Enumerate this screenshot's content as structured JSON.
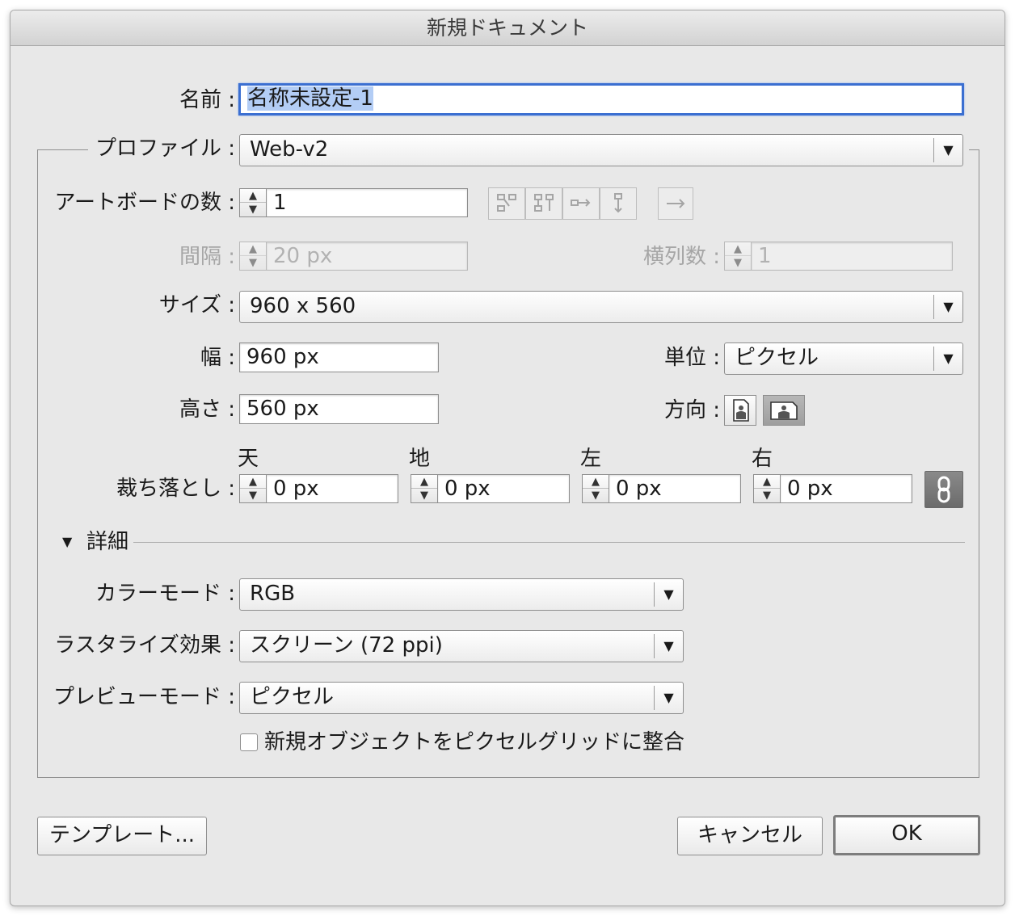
{
  "window": {
    "title": "新規ドキュメント"
  },
  "name": {
    "label": "名前 :",
    "value": "名称未設定-1"
  },
  "profile": {
    "label": "プロファイル :",
    "value": "Web-v2"
  },
  "artboards": {
    "label": "アートボードの数 :",
    "value": "1",
    "spacing_label": "間隔 :",
    "spacing_value": "20 px",
    "columns_label": "横列数 :",
    "columns_value": "1",
    "layout_icons": [
      "grid-by-row-icon",
      "grid-by-column-icon",
      "arrange-by-row-icon",
      "arrange-by-column-icon",
      "right-to-left-icon"
    ]
  },
  "size": {
    "label": "サイズ :",
    "value": "960 x 560"
  },
  "width": {
    "label": "幅 :",
    "value": "960 px"
  },
  "height": {
    "label": "高さ :",
    "value": "560 px"
  },
  "units": {
    "label": "単位 :",
    "value": "ピクセル"
  },
  "orientation": {
    "label": "方向 :",
    "selected": "landscape"
  },
  "bleed": {
    "label": "裁ち落とし :",
    "top_label": "天",
    "top_value": "0 px",
    "bottom_label": "地",
    "bottom_value": "0 px",
    "left_label": "左",
    "left_value": "0 px",
    "right_label": "右",
    "right_value": "0 px",
    "linked": true
  },
  "advanced": {
    "label": "詳細",
    "expanded": true,
    "color_mode_label": "カラーモード :",
    "color_mode_value": "RGB",
    "raster_label": "ラスタライズ効果 :",
    "raster_value": "スクリーン (72 ppi)",
    "preview_label": "プレビューモード :",
    "preview_value": "ピクセル",
    "align_label": "新規オブジェクトをピクセルグリッドに整合",
    "align_checked": false
  },
  "buttons": {
    "templates": "テンプレート...",
    "cancel": "キャンセル",
    "ok": "OK"
  },
  "colors": {
    "focus": "#3b6fd1",
    "selection": "#b3cdf5",
    "dialog_bg": "#e8e8e8"
  }
}
